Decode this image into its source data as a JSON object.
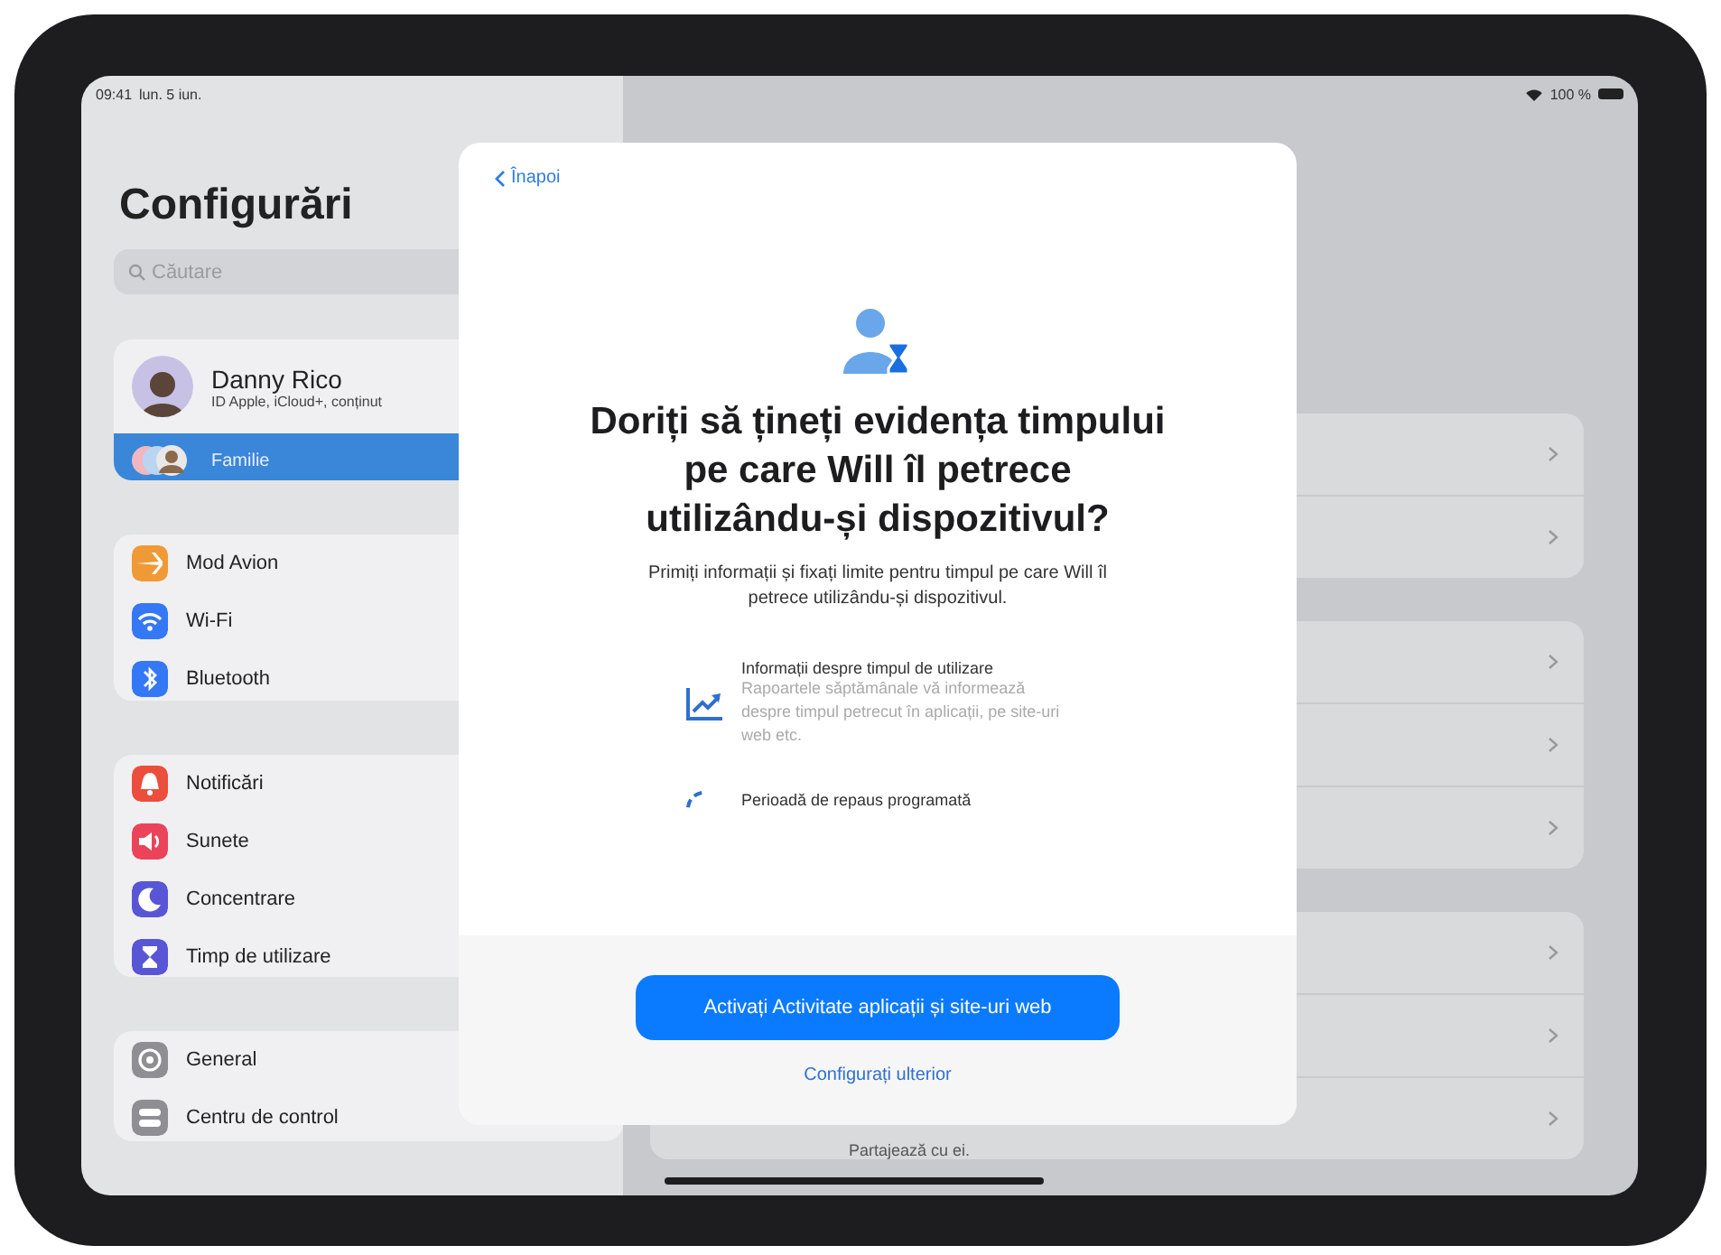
{
  "status_bar": {
    "time": "09:41",
    "date": "lun. 5 iun.",
    "battery": "100 %"
  },
  "sidebar": {
    "title": "Configurări",
    "search": {
      "placeholder": "Căutare"
    },
    "account": {
      "name": "Danny Rico",
      "subtitle": "ID Apple, iCloud+, conținut"
    },
    "family": {
      "label": "Familie",
      "selected": true
    },
    "groups": [
      {
        "items": [
          {
            "label": "Mod Avion",
            "color": "#f09a37"
          },
          {
            "label": "Wi-Fi",
            "color": "#3478f6"
          },
          {
            "label": "Bluetooth",
            "color": "#3478f6"
          }
        ]
      },
      {
        "items": [
          {
            "label": "Notificări",
            "color": "#eb4e3d"
          },
          {
            "label": "Sunete",
            "color": "#eb445a"
          },
          {
            "label": "Concentrare",
            "color": "#5856d6"
          },
          {
            "label": "Timp de utilizare",
            "color": "#5856d6"
          }
        ]
      },
      {
        "items": [
          {
            "label": "General",
            "color": "#8e8e93"
          },
          {
            "label": "Centru de control",
            "color": "#8e8e93"
          }
        ]
      }
    ]
  },
  "detail": {
    "caption": "Partajează cu ei."
  },
  "modal": {
    "back": "Înapoi",
    "title": "Doriți să țineți evidența timpului pe care Will îl petrece utilizându-și dispozitivul?",
    "subtitle": "Primiți informații și fixați limite pentru timpul pe care Will îl petrece utilizându-și dispozitivul.",
    "features": [
      {
        "title": "Informații despre timpul de utilizare",
        "description": "Rapoartele săptămânale vă informează despre timpul petrecut în aplicații, pe site-uri web etc."
      },
      {
        "title": "Perioadă de repaus programată"
      }
    ],
    "primary_button": "Activați Activitate aplicații și site-uri web",
    "secondary_button": "Configurați ulterior"
  }
}
